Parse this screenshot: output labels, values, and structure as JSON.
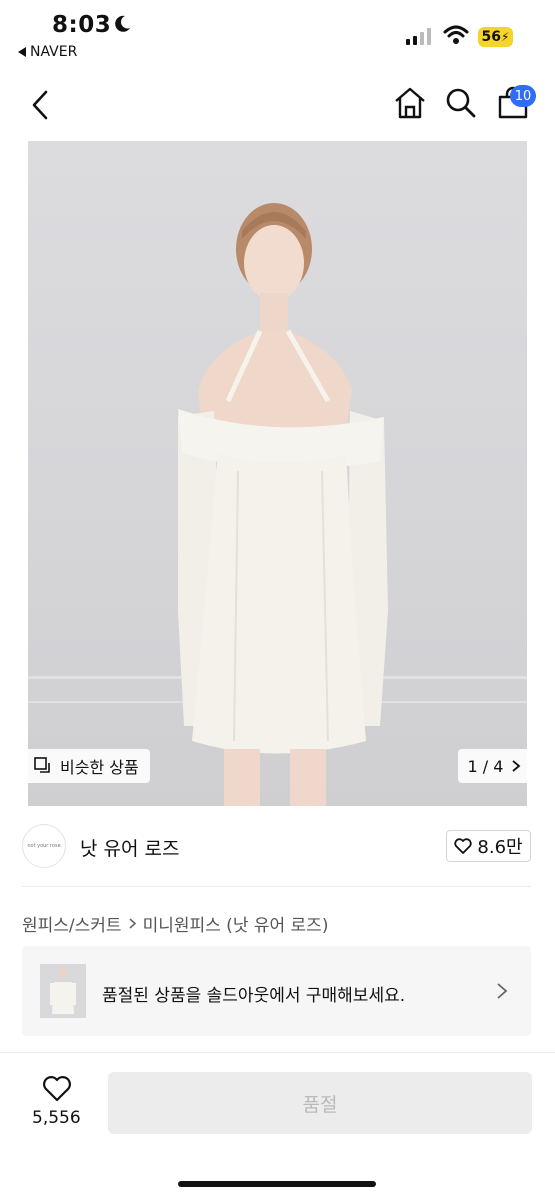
{
  "status_bar": {
    "time": "8:03",
    "back_app": "NAVER",
    "battery": "56"
  },
  "nav": {
    "cart_count": "10"
  },
  "image": {
    "similar_label": "비슷한 상품",
    "page_indicator": "1 / 4"
  },
  "brand": {
    "logo_text": "not your rose",
    "name": "낫 유어 로즈",
    "likes": "8.6만"
  },
  "breadcrumb": {
    "category": "원피스/스커트",
    "subcategory": "미니원피스 (낫 유어 로즈)"
  },
  "banner": {
    "text": "품절된 상품을 솔드아웃에서 구매해보세요."
  },
  "bottom_bar": {
    "wish_count": "5,556",
    "action_label": "품절"
  },
  "colors": {
    "accent": "#2f6df6",
    "battery": "#f5d52b",
    "disabled_button": "#ececec"
  }
}
